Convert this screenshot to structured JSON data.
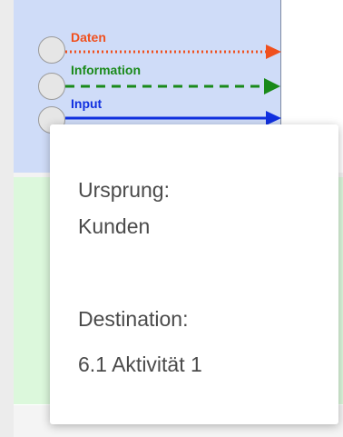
{
  "legend": {
    "items": [
      {
        "label": "Daten",
        "color": "#f0501e",
        "line_style": "dotted"
      },
      {
        "label": "Information",
        "color": "#1a8a1a",
        "line_style": "dashed"
      },
      {
        "label": "Input",
        "color": "#1030e0",
        "line_style": "solid"
      }
    ]
  },
  "lanes": {
    "top_color": "#cfdcf8",
    "bottom_color": "#dcf8dc"
  },
  "tooltip": {
    "origin_label": "Ursprung:",
    "origin_value": "Kunden",
    "destination_label": "Destination:",
    "destination_value": "6.1 Aktivität 1"
  }
}
